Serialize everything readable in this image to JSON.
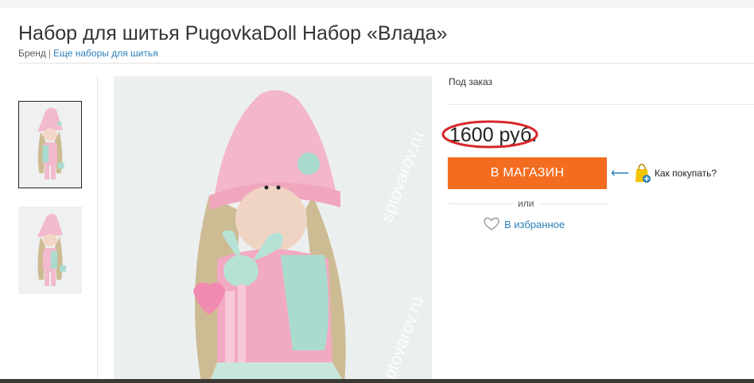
{
  "product": {
    "title": "Набор для шитья PugovkaDoll Набор «Влада»",
    "brand_label": "Бренд",
    "separator": "|",
    "more_link": "Еще наборы для шитья"
  },
  "offer": {
    "availability": "Под заказ",
    "price": "1600 руб.",
    "shop_button": "В МАГАЗИН",
    "how_to_buy": "Как покупать?",
    "or": "или",
    "favorites": "В избранное"
  },
  "watermark": "sptovarov.ru",
  "colors": {
    "accent": "#f36d21",
    "link": "#2a7fb8",
    "price_circle": "#d8262b"
  }
}
